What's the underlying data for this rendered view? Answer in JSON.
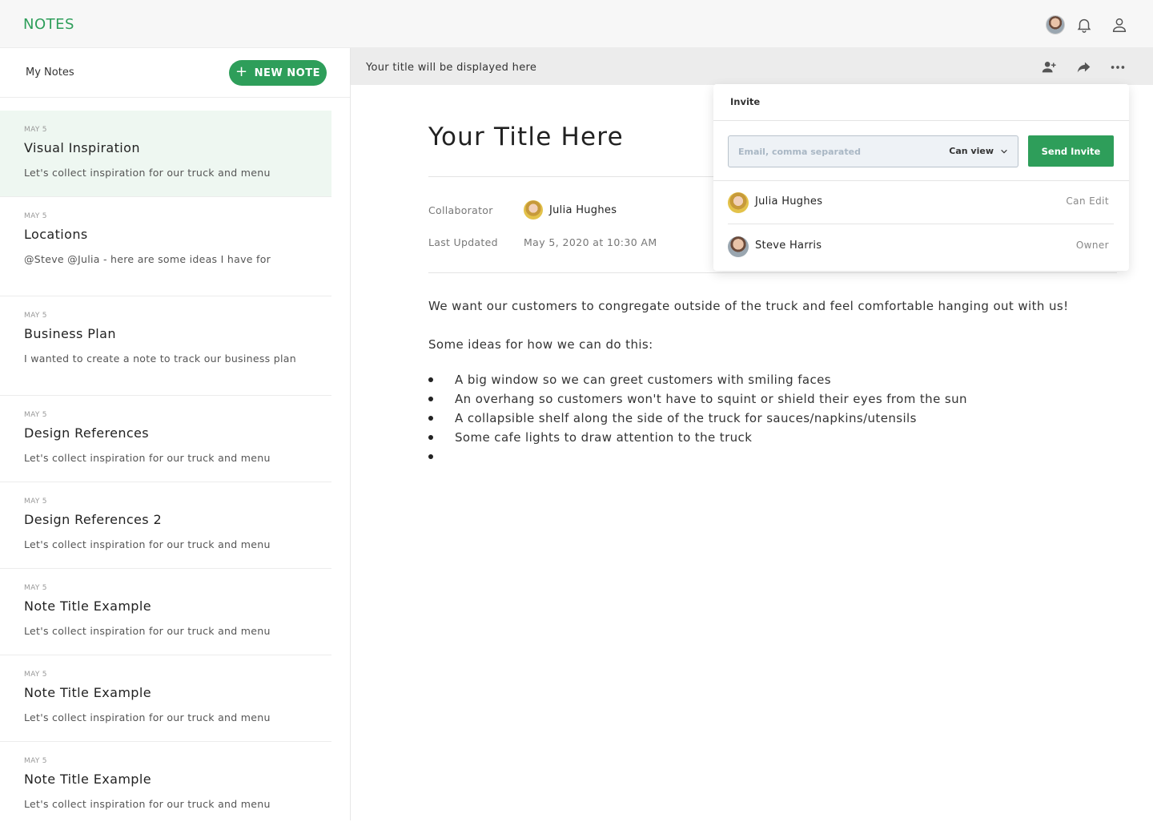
{
  "app": {
    "brand": "NOTES"
  },
  "topbar": {
    "icons": [
      "avatar",
      "bell-icon",
      "user-icon"
    ]
  },
  "sidebar": {
    "heading": "My Notes",
    "new_note_label": "NEW NOTE",
    "notes": [
      {
        "date": "MAY 5",
        "title": "Visual Inspiration",
        "preview": "Let's collect inspiration for our truck and menu",
        "active": true
      },
      {
        "date": "MAY 5",
        "title": "Locations",
        "preview": "@Steve @Julia - here are some ideas I have for"
      },
      {
        "date": "MAY 5",
        "title": "Business Plan",
        "preview": "I wanted to create a note to track our business plan"
      },
      {
        "date": "MAY 5",
        "title": "Design References",
        "preview": "Let's collect inspiration for our truck and menu"
      },
      {
        "date": "MAY 5",
        "title": "Design References 2",
        "preview": "Let's collect inspiration for our truck and menu"
      },
      {
        "date": "MAY 5",
        "title": "Note Title Example",
        "preview": "Let's collect inspiration for our truck and menu"
      },
      {
        "date": "MAY 5",
        "title": "Note Title Example",
        "preview": "Let's collect inspiration for our truck and menu"
      },
      {
        "date": "MAY 5",
        "title": "Note Title Example",
        "preview": "Let's collect inspiration for our truck and menu"
      }
    ]
  },
  "main": {
    "bar_title": "Your title will be displayed here",
    "doc_title": "Your Title Here",
    "collaborator_label": "Collaborator",
    "collaborator_name": "Julia Hughes",
    "last_updated_label": "Last Updated",
    "last_updated_value": "May 5, 2020 at 10:30 AM",
    "paragraph1": "We want our customers to congregate outside of the truck and feel comfortable hanging out with us!",
    "paragraph2": "Some ideas for how we can do this:",
    "bullets": [
      "A big window so we can greet customers with smiling faces",
      "An overhang so customers won't have to squint or shield their eyes from the sun",
      "A collapsible shelf along the side of the truck for sauces/napkins/utensils",
      "Some cafe lights to draw attention to the truck",
      ""
    ]
  },
  "invite": {
    "label": "Invite",
    "placeholder": "Email, comma separated",
    "permission": "Can view",
    "send_label": "Send Invite",
    "members": [
      {
        "name": "Julia Hughes",
        "role": "Can Edit"
      },
      {
        "name": "Steve Harris",
        "role": "Owner"
      }
    ]
  },
  "colors": {
    "accent": "#2e9e5a",
    "active_note_bg": "#eef7f1"
  }
}
